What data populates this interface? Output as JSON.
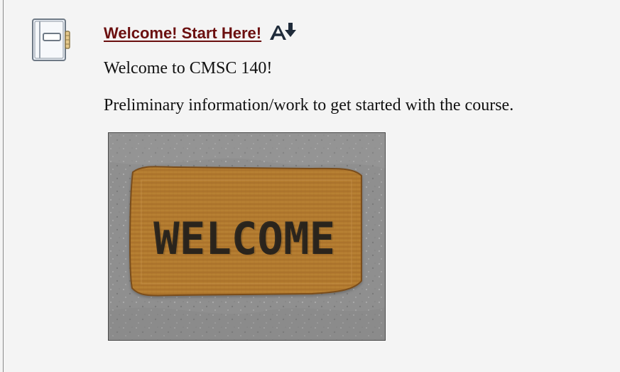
{
  "module": {
    "title": "Welcome! Start Here!",
    "icon": "notebook-icon",
    "action_icon": "sort-download-icon"
  },
  "content": {
    "line1": "Welcome to CMSC 140!",
    "line2": "Preliminary information/work to get started with the course."
  },
  "image": {
    "mat_text": "WELCOME"
  },
  "colors": {
    "background": "#f4f4f4",
    "link": "#6b0f0f",
    "icon_dark": "#1f2b3a"
  }
}
